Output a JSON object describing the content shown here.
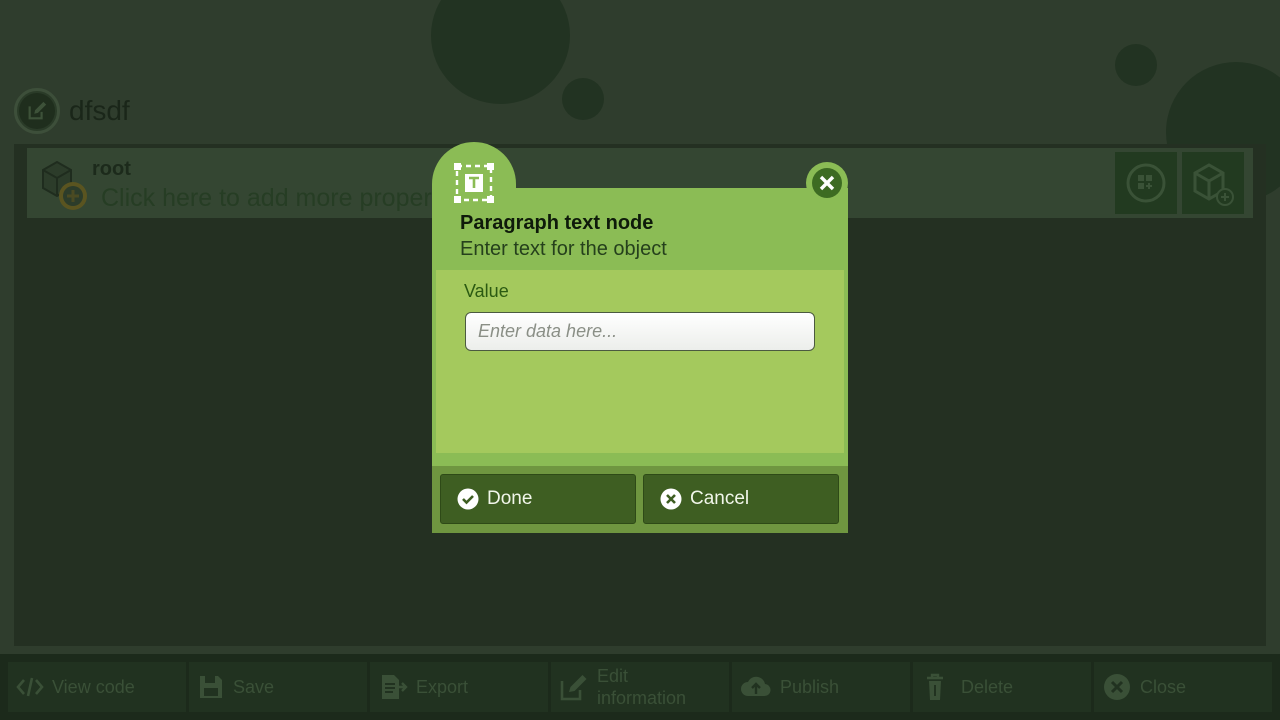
{
  "header": {
    "title": "dfsdf"
  },
  "tree": {
    "root_label": "root",
    "add_hint": "Click here to add more properties"
  },
  "dialog": {
    "title": "Paragraph text node",
    "subtitle": "Enter text for the object",
    "field_label": "Value",
    "field_value": "",
    "field_placeholder": "Enter data here...",
    "done_label": "Done",
    "cancel_label": "Cancel"
  },
  "footer": {
    "items": [
      {
        "label": "View code",
        "icon": "code-icon"
      },
      {
        "label": "Save",
        "icon": "floppy-icon"
      },
      {
        "label": "Export",
        "icon": "export-icon"
      },
      {
        "label": "Edit information",
        "icon": "edit-icon"
      },
      {
        "label": "Publish",
        "icon": "cloud-upload-icon"
      },
      {
        "label": "Delete",
        "icon": "trash-icon"
      },
      {
        "label": "Close",
        "icon": "close-icon"
      }
    ]
  },
  "colors": {
    "dialog_green": "#8bbc55",
    "body_green": "#a4c95d",
    "button_green": "#3e5e22",
    "overlay_bg": "#2f3d2d"
  }
}
